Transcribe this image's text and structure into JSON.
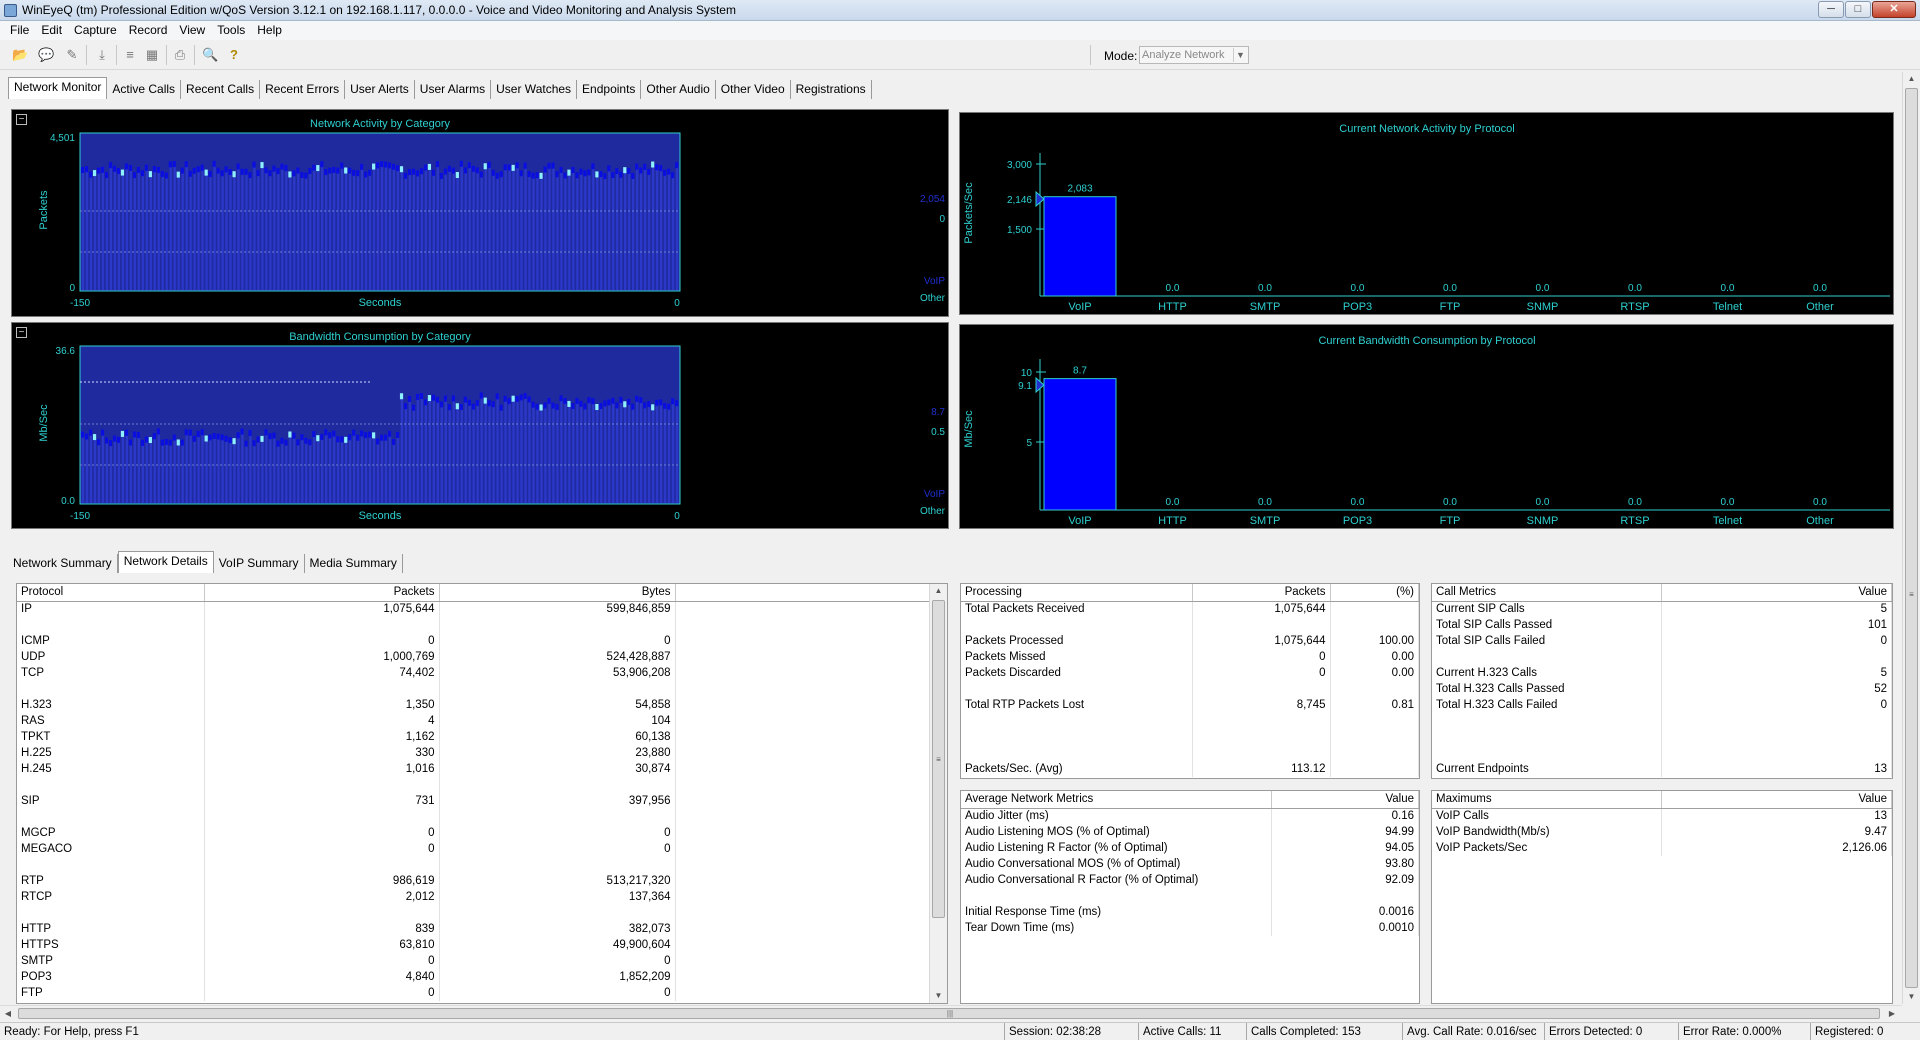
{
  "window": {
    "title": "WinEyeQ (tm) Professional Edition w/QoS Version 3.12.1 on 192.168.1.117, 0.0.0.0 - Voice and Video Monitoring and Analysis System",
    "min": "─",
    "max": "□",
    "close": "✕"
  },
  "menu": [
    "File",
    "Edit",
    "Capture",
    "Record",
    "View",
    "Tools",
    "Help"
  ],
  "toolbar": {
    "mode_label": "Mode:",
    "mode_value": "Analyze Network",
    "icons": [
      "open-icon",
      "comment-icon",
      "comment-mark-icon",
      "download-icon",
      "stack-icon",
      "traffic-light-icon",
      "print-icon",
      "search-icon",
      "help-icon"
    ],
    "glyphs": [
      "📂",
      "💬",
      "✎",
      "⤓",
      "≡",
      "▦",
      "⎙",
      "🔍",
      "?"
    ]
  },
  "top_tabs": [
    "Network Monitor",
    "Active Calls",
    "Recent Calls",
    "Recent Errors",
    "User Alerts",
    "User Alarms",
    "User Watches",
    "Endpoints",
    "Other Audio",
    "Other Video",
    "Registrations"
  ],
  "bottom_tabs": [
    "Network Summary",
    "Network Details",
    "VoIP Summary",
    "Media Summary"
  ],
  "collapse_glyph": "−",
  "colors": {
    "chart_cyan": "#2fd0d0",
    "bar_blue": "#0000ff",
    "bar_dark": "#1f2a9e"
  },
  "charts": {
    "activity": {
      "title": "Network Activity by Category",
      "ylabel": "Packets",
      "xlabel": "Seconds",
      "ytick_top": "4,501",
      "ytick_bottom": "0",
      "xtick_left": "-150",
      "xtick_right": "0",
      "legend_value_voip": "2,054",
      "legend_value_other": "0",
      "legend_voip": "VoIP",
      "legend_other": "Other"
    },
    "bandwidth": {
      "title": "Bandwidth Consumption by Category",
      "ylabel": "Mb/Sec",
      "xlabel": "Seconds",
      "ytick_top": "36.6",
      "ytick_bottom": "0.0",
      "xtick_left": "-150",
      "xtick_right": "0",
      "legend_value_voip": "8.7",
      "legend_value_other": "0.5",
      "legend_voip": "VoIP",
      "legend_other": "Other"
    },
    "protocol_packets": {
      "title": "Current Network Activity by Protocol",
      "ylabel": "Packets/Sec",
      "ticks": [
        "3,000",
        "2,146",
        "1,500"
      ],
      "marker": "2,146"
    },
    "protocol_bandwidth": {
      "title": "Current Bandwidth Consumption by Protocol",
      "ylabel": "Mb/Sec",
      "ticks": [
        "10",
        "9.1",
        "5"
      ],
      "marker": "9.1"
    }
  },
  "chart_data": [
    {
      "type": "bar",
      "title": "Network Activity by Category",
      "xlabel": "Seconds",
      "ylabel": "Packets",
      "xlim": [
        -150,
        0
      ],
      "ylim": [
        0,
        4501
      ],
      "series": [
        {
          "name": "VoIP",
          "level": 2054
        },
        {
          "name": "Other",
          "level": 0
        }
      ]
    },
    {
      "type": "bar",
      "title": "Bandwidth Consumption by Category",
      "xlabel": "Seconds",
      "ylabel": "Mb/Sec",
      "xlim": [
        -150,
        0
      ],
      "ylim": [
        0,
        36.6
      ],
      "series": [
        {
          "name": "VoIP",
          "level": 8.7
        },
        {
          "name": "Other",
          "level": 0.5
        }
      ]
    },
    {
      "type": "bar",
      "title": "Current Network Activity by Protocol",
      "ylabel": "Packets/Sec",
      "ylim": [
        0,
        3000
      ],
      "categories": [
        "VoIP",
        "HTTP",
        "SMTP",
        "POP3",
        "FTP",
        "SNMP",
        "RTSP",
        "Telnet",
        "Other"
      ],
      "values": [
        2083,
        0,
        0,
        0,
        0,
        0,
        0,
        0,
        0
      ],
      "labels": [
        "2,083",
        "0.0",
        "0.0",
        "0.0",
        "0.0",
        "0.0",
        "0.0",
        "0.0",
        "0.0"
      ]
    },
    {
      "type": "bar",
      "title": "Current Bandwidth Consumption by Protocol",
      "ylabel": "Mb/Sec",
      "ylim": [
        0,
        10
      ],
      "categories": [
        "VoIP",
        "HTTP",
        "SMTP",
        "POP3",
        "FTP",
        "SNMP",
        "RTSP",
        "Telnet",
        "Other"
      ],
      "values": [
        8.7,
        0,
        0,
        0,
        0,
        0,
        0,
        0,
        0
      ],
      "labels": [
        "8.7",
        "0.0",
        "0.0",
        "0.0",
        "0.0",
        "0.0",
        "0.0",
        "0.0",
        "0.0"
      ]
    }
  ],
  "protocol_table": {
    "headers": [
      "Protocol",
      "Packets",
      "Bytes"
    ],
    "rows": [
      [
        "IP",
        "1,075,644",
        "599,846,859"
      ],
      [
        "",
        "",
        ""
      ],
      [
        "ICMP",
        "0",
        "0"
      ],
      [
        "UDP",
        "1,000,769",
        "524,428,887"
      ],
      [
        "TCP",
        "74,402",
        "53,906,208"
      ],
      [
        "",
        "",
        ""
      ],
      [
        "H.323",
        "1,350",
        "54,858"
      ],
      [
        "RAS",
        "4",
        "104"
      ],
      [
        "TPKT",
        "1,162",
        "60,138"
      ],
      [
        "H.225",
        "330",
        "23,880"
      ],
      [
        "H.245",
        "1,016",
        "30,874"
      ],
      [
        "",
        "",
        ""
      ],
      [
        "SIP",
        "731",
        "397,956"
      ],
      [
        "",
        "",
        ""
      ],
      [
        "MGCP",
        "0",
        "0"
      ],
      [
        "MEGACO",
        "0",
        "0"
      ],
      [
        "",
        "",
        ""
      ],
      [
        "RTP",
        "986,619",
        "513,217,320"
      ],
      [
        "RTCP",
        "2,012",
        "137,364"
      ],
      [
        "",
        "",
        ""
      ],
      [
        "HTTP",
        "839",
        "382,073"
      ],
      [
        "HTTPS",
        "63,810",
        "49,900,604"
      ],
      [
        "SMTP",
        "0",
        "0"
      ],
      [
        "POP3",
        "4,840",
        "1,852,209"
      ],
      [
        "FTP",
        "0",
        "0"
      ]
    ]
  },
  "processing_table": {
    "headers": [
      "Processing",
      "Packets",
      "(%)"
    ],
    "rows": [
      [
        "Total Packets Received",
        "1,075,644",
        ""
      ],
      [
        "",
        "",
        ""
      ],
      [
        "Packets Processed",
        "1,075,644",
        "100.00"
      ],
      [
        "Packets Missed",
        "0",
        "0.00"
      ],
      [
        "Packets Discarded",
        "0",
        "0.00"
      ],
      [
        "",
        "",
        ""
      ],
      [
        "Total RTP Packets Lost",
        "8,745",
        "0.81"
      ],
      [
        "",
        "",
        ""
      ],
      [
        "",
        "",
        ""
      ],
      [
        "",
        "",
        ""
      ],
      [
        "Packets/Sec. (Avg)",
        "113.12",
        ""
      ]
    ]
  },
  "call_metrics_table": {
    "headers": [
      "Call Metrics",
      "Value"
    ],
    "rows": [
      [
        "Current SIP Calls",
        "5"
      ],
      [
        "Total SIP Calls Passed",
        "101"
      ],
      [
        "Total SIP Calls Failed",
        "0"
      ],
      [
        "",
        ""
      ],
      [
        "Current H.323 Calls",
        "5"
      ],
      [
        "Total H.323 Calls Passed",
        "52"
      ],
      [
        "Total H.323 Calls Failed",
        "0"
      ],
      [
        "",
        ""
      ],
      [
        "",
        ""
      ],
      [
        "",
        ""
      ],
      [
        "Current Endpoints",
        "13"
      ]
    ]
  },
  "avg_metrics_table": {
    "headers": [
      "Average Network Metrics",
      "Value"
    ],
    "rows": [
      [
        "Audio Jitter (ms)",
        "0.16"
      ],
      [
        "Audio Listening MOS (% of Optimal)",
        "94.99"
      ],
      [
        "Audio Listening R Factor (% of Optimal)",
        "94.05"
      ],
      [
        "Audio Conversational MOS (% of Optimal)",
        "93.80"
      ],
      [
        "Audio Conversational R Factor (% of Optimal)",
        "92.09"
      ],
      [
        "",
        ""
      ],
      [
        "Initial Response Time (ms)",
        "0.0016"
      ],
      [
        "Tear Down Time (ms)",
        "0.0010"
      ]
    ]
  },
  "maximums_table": {
    "headers": [
      "Maximums",
      "Value"
    ],
    "rows": [
      [
        "VoIP Calls",
        "13"
      ],
      [
        "VoIP Bandwidth(Mb/s)",
        "9.47"
      ],
      [
        "VoIP Packets/Sec",
        "2,126.06"
      ]
    ]
  },
  "statusbar": {
    "help": "Ready: For Help, press F1",
    "session": "Session: 02:38:28",
    "active_calls": "Active Calls: 11",
    "calls_completed": "Calls Completed: 153",
    "avg_call_rate": "Avg. Call Rate: 0.016/sec",
    "errors": "Errors Detected: 0",
    "error_rate": "Error Rate: 0.000%",
    "registered": "Registered: 0"
  },
  "scroll_glyphs": {
    "up": "▲",
    "down": "▼",
    "left": "◀",
    "right": "▶",
    "grip": "≡",
    "grip_h": "|||"
  }
}
